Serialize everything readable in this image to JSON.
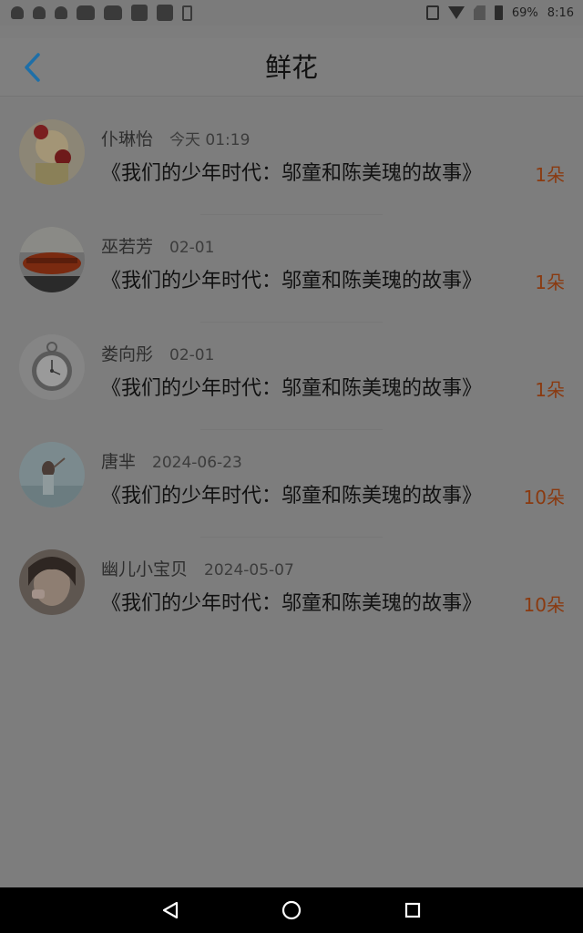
{
  "status_bar": {
    "battery_percent": "69%",
    "time": "8:16"
  },
  "header": {
    "title": "鲜花",
    "back_icon": "chevron-left-icon",
    "accent_color": "#1e88c7"
  },
  "items": [
    {
      "name": "仆琳怡",
      "time": "今天 01:19",
      "book": "《我们的少年时代：邬童和陈美瑰的故事》",
      "count": "1朵"
    },
    {
      "name": "巫若芳",
      "time": "02-01",
      "book": "《我们的少年时代：邬童和陈美瑰的故事》",
      "count": "1朵"
    },
    {
      "name": "娄向彤",
      "time": "02-01",
      "book": "《我们的少年时代：邬童和陈美瑰的故事》",
      "count": "1朵"
    },
    {
      "name": "唐芈",
      "time": "2024-06-23",
      "book": "《我们的少年时代：邬童和陈美瑰的故事》",
      "count": "10朵"
    },
    {
      "name": "幽儿小宝贝",
      "time": "2024-05-07",
      "book": "《我们的少年时代：邬童和陈美瑰的故事》",
      "count": "10朵"
    }
  ],
  "nav_bar": {
    "back": "triangle-back-icon",
    "home": "circle-home-icon",
    "recents": "square-recents-icon"
  }
}
